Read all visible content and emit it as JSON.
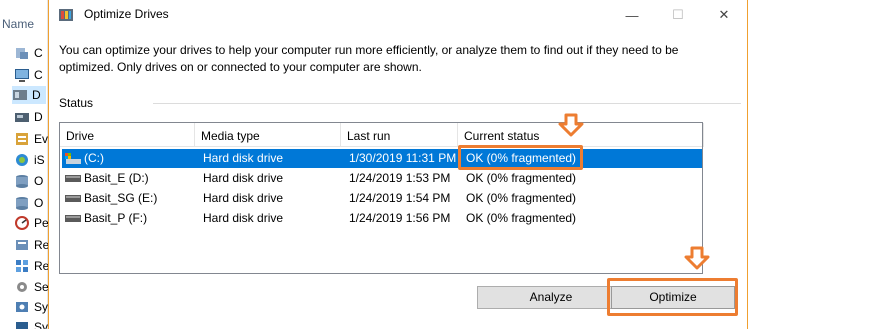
{
  "background_window": {
    "header": "Name",
    "items": [
      "C",
      "C",
      "D",
      "D",
      "Ev",
      "iS",
      "O",
      "O",
      "Pe",
      "Re",
      "Re",
      "Se",
      "Sy",
      "Sy"
    ]
  },
  "dialog": {
    "title": "Optimize Drives",
    "controls": {
      "minimize": "—",
      "maximize": "☐",
      "close": "✕"
    },
    "description": "You can optimize your drives to help your computer run more efficiently, or analyze them to find out if they need to be optimized. Only drives on or connected to your computer are shown.",
    "status_label": "Status",
    "columns": [
      "Drive",
      "Media type",
      "Last run",
      "Current status"
    ],
    "drives": [
      {
        "drive": "(C:)",
        "media": "Hard disk drive",
        "last_run": "1/30/2019 11:31 PM",
        "status": "OK (0% fragmented)",
        "selected": true
      },
      {
        "drive": "Basit_E (D:)",
        "media": "Hard disk drive",
        "last_run": "1/24/2019 1:53 PM",
        "status": "OK (0% fragmented)",
        "selected": false
      },
      {
        "drive": "Basit_SG (E:)",
        "media": "Hard disk drive",
        "last_run": "1/24/2019 1:54 PM",
        "status": "OK (0% fragmented)",
        "selected": false
      },
      {
        "drive": "Basit_P (F:)",
        "media": "Hard disk drive",
        "last_run": "1/24/2019 1:56 PM",
        "status": "OK (0% fragmented)",
        "selected": false
      }
    ],
    "buttons": {
      "analyze": "Analyze",
      "optimize": "Optimize"
    }
  },
  "colors": {
    "selection": "#0078d7",
    "annotation": "#ed7d31",
    "button_face": "#e1e1e1"
  }
}
